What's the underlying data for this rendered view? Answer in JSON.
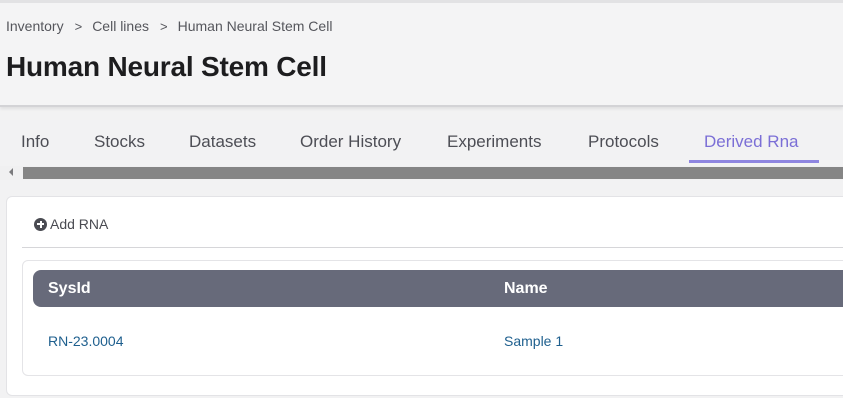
{
  "breadcrumb": {
    "items": [
      "Inventory",
      "Cell lines"
    ],
    "current": "Human Neural Stem Cell",
    "separator": ">"
  },
  "page": {
    "title": "Human Neural Stem Cell"
  },
  "tabs": [
    {
      "label": "Info",
      "active": false
    },
    {
      "label": "Stocks",
      "active": false
    },
    {
      "label": "Datasets",
      "active": false
    },
    {
      "label": "Order History",
      "active": false
    },
    {
      "label": "Experiments",
      "active": false
    },
    {
      "label": "Protocols",
      "active": false
    },
    {
      "label": "Derived Rna",
      "active": true
    }
  ],
  "toolbar": {
    "add_label": "Add RNA",
    "add_icon": "plus-circle-icon"
  },
  "table": {
    "columns": [
      "SysId",
      "Name"
    ],
    "rows": [
      {
        "sysid": "RN-23.0004",
        "name": "Sample 1"
      }
    ]
  },
  "colors": {
    "accent": "#7b6fd6",
    "table_header": "#676a7a",
    "link": "#1e5f8e"
  }
}
